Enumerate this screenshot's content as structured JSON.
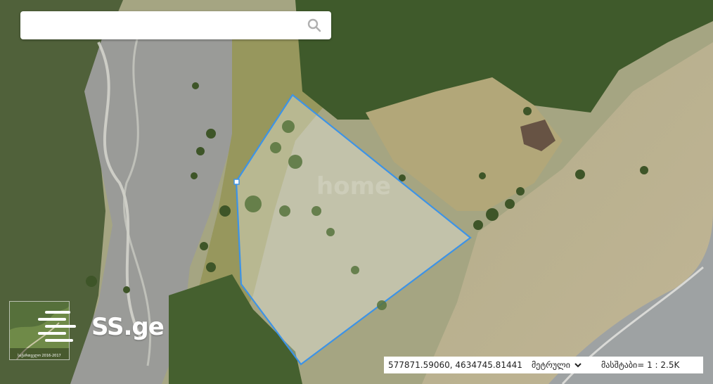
{
  "search": {
    "placeholder": "",
    "value": ""
  },
  "minimap": {
    "caption": "საქართველო 2016-2017"
  },
  "logo": {
    "text": "SS.ge"
  },
  "watermark": {
    "text": "home"
  },
  "status": {
    "coordinates": "577871.59060, 4634745.81441",
    "units": "მეტრული",
    "scale": "მასშტაბი= 1 : 2.5K"
  },
  "colors": {
    "parcel_stroke": "#3d93e6",
    "parcel_fill": "#ffffff"
  }
}
